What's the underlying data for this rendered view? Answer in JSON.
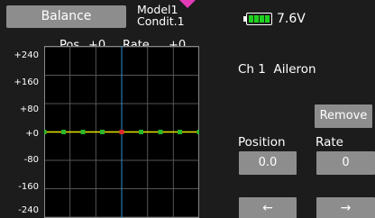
{
  "header": {
    "tab_label": "Balance",
    "model_name": "Model1",
    "condition": "Condit.1",
    "battery_voltage": "7.6V",
    "battery_level": 1.0
  },
  "graph": {
    "pos_label": "Pos.",
    "pos_value": "+0",
    "rate_label": "Rate",
    "rate_value": "+0",
    "y_ticks": [
      "+240",
      "+160",
      "+80",
      "+0",
      "-80",
      "-160",
      "-240"
    ],
    "x_range": [
      -240,
      240
    ],
    "y_range": [
      -240,
      240
    ],
    "cursor_x": 0,
    "curve_points": [
      [
        -240,
        0
      ],
      [
        -180,
        0
      ],
      [
        -120,
        0
      ],
      [
        -60,
        0
      ],
      [
        0,
        0
      ],
      [
        60,
        0
      ],
      [
        120,
        0
      ],
      [
        180,
        0
      ],
      [
        240,
        0
      ]
    ],
    "colors": {
      "curve": "#e8e800",
      "point": "#29b52d",
      "selected_point": "#e0262a",
      "cursor": "#2e8fcc",
      "grid": "#555555"
    }
  },
  "channel": {
    "label": "Ch 1",
    "function": "Aileron"
  },
  "controls": {
    "remove_label": "Remove",
    "position_label": "Position",
    "position_value": "0.0",
    "rate_label": "Rate",
    "rate_value": "0",
    "prev_label": "←",
    "next_label": "→"
  }
}
